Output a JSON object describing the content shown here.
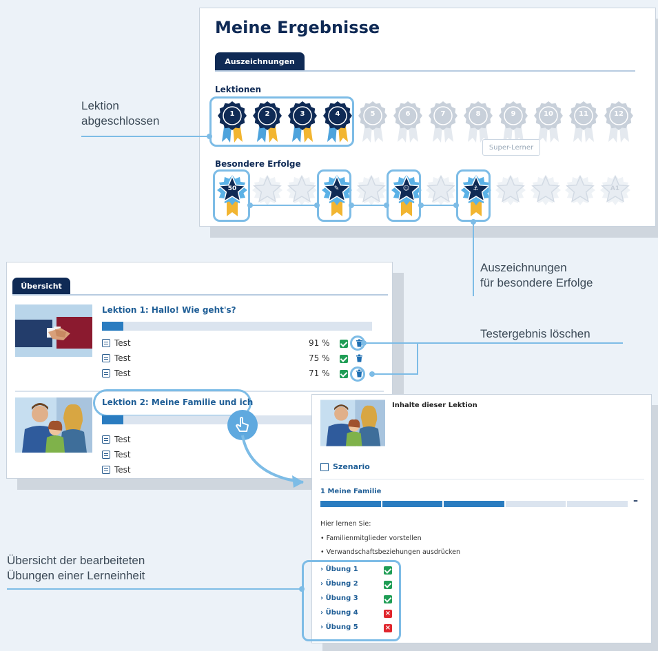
{
  "colors": {
    "navy": "#0f2a55",
    "accent": "#2a7cc0",
    "highlight": "#7dbce6",
    "ok": "#1f9d55",
    "fail": "#e0262d"
  },
  "results": {
    "title": "Meine Ergebnisse",
    "tab": "Auszeichnungen",
    "lessons_heading": "Lektionen",
    "lessons": [
      {
        "label": "1",
        "earned": true
      },
      {
        "label": "2",
        "earned": true
      },
      {
        "label": "3",
        "earned": true
      },
      {
        "label": "4",
        "earned": true
      },
      {
        "label": "5",
        "earned": false
      },
      {
        "label": "6",
        "earned": false
      },
      {
        "label": "7",
        "earned": false
      },
      {
        "label": "8",
        "earned": false
      },
      {
        "label": "9",
        "earned": false
      },
      {
        "label": "10",
        "earned": false
      },
      {
        "label": "11",
        "earned": false
      },
      {
        "label": "12",
        "earned": false
      }
    ],
    "tooltip": "Super-Lerner",
    "special_heading": "Besondere Erfolge",
    "special": [
      {
        "glyph": "50",
        "earned": true
      },
      {
        "glyph": "",
        "earned": false
      },
      {
        "glyph": "",
        "earned": false
      },
      {
        "glyph": "✎",
        "earned": true
      },
      {
        "glyph": "",
        "earned": false
      },
      {
        "glyph": "☺",
        "earned": true
      },
      {
        "glyph": "",
        "earned": false
      },
      {
        "glyph": "⚓",
        "earned": true
      },
      {
        "glyph": "",
        "earned": false
      },
      {
        "glyph": "",
        "earned": false
      },
      {
        "glyph": "",
        "earned": false
      },
      {
        "glyph": "A1",
        "earned": false
      }
    ]
  },
  "overview": {
    "tab": "Übersicht",
    "lessons": [
      {
        "title": "Lektion 1: Hallo! Wie geht's?",
        "progress": 0.08,
        "tests": [
          {
            "label": "Test",
            "score": "91 %"
          },
          {
            "label": "Test",
            "score": "75 %"
          },
          {
            "label": "Test",
            "score": "71 %"
          }
        ]
      },
      {
        "title": "Lektion 2: Meine Familie und ich",
        "progress": 0.08,
        "tests": [
          {
            "label": "Test"
          },
          {
            "label": "Test"
          },
          {
            "label": "Test"
          }
        ]
      }
    ]
  },
  "detail": {
    "heading": "Inhalte dieser Lektion",
    "scenario": "Szenario",
    "unit_title": "1 Meine Familie",
    "segments_done": 3,
    "segments_total": 5,
    "collapse": "–",
    "learn_heading": "Hier lernen Sie:",
    "bullets": [
      "Familienmitglieder vorstellen",
      "Verwandschaftsbeziehungen ausdrücken"
    ],
    "exercises": [
      {
        "label": "› Übung 1",
        "passed": true
      },
      {
        "label": "› Übung 2",
        "passed": true
      },
      {
        "label": "› Übung 3",
        "passed": true
      },
      {
        "label": "› Übung 4",
        "passed": false
      },
      {
        "label": "› Übung 5",
        "passed": false
      }
    ]
  },
  "callouts": {
    "lesson_done": [
      "Lektion",
      "abgeschlossen"
    ],
    "special": [
      "Auszeichnungen",
      "für besondere Erfolge"
    ],
    "delete": "Testergebnis löschen",
    "exercises": [
      "Übersicht der bearbeiteten",
      "Übungen einer Lerneinheit"
    ]
  }
}
